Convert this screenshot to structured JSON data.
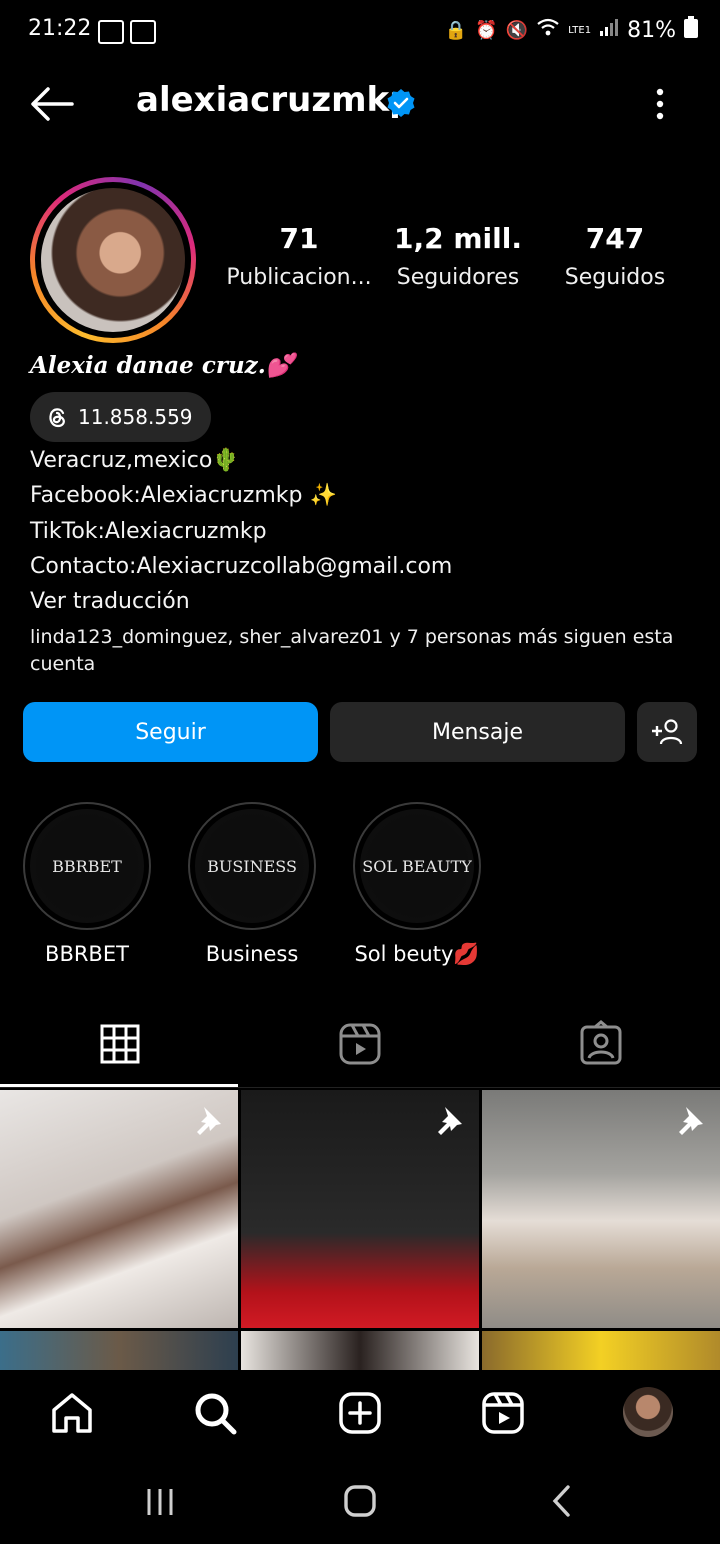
{
  "status": {
    "time": "21:22",
    "battery": "81%",
    "net": "LTE1"
  },
  "header": {
    "username": "alexiacruzmkp",
    "verified": true
  },
  "stats": [
    {
      "value": "71",
      "label": "Publicacion..."
    },
    {
      "value": "1,2 mill.",
      "label": "Seguidores"
    },
    {
      "value": "747",
      "label": "Seguidos"
    }
  ],
  "profile": {
    "full_name": "Alexia danae cruz.💕",
    "threads_count": "11.858.559",
    "bio": [
      "Veracruz,mexico🌵",
      "Facebook:Alexiacruzmkp ✨",
      "TikTok:Alexiacruzmkp",
      "Contacto:Alexiacruzcollab@gmail.com"
    ],
    "translate": "Ver traducción",
    "followed_by": "linda123_dominguez, sher_alvarez01 y 7 personas más siguen esta cuenta"
  },
  "actions": {
    "follow": "Seguir",
    "message": "Mensaje"
  },
  "highlights": [
    {
      "cover": "BBRBET",
      "label": "BBRBET"
    },
    {
      "cover": "BUSINESS",
      "label": "Business"
    },
    {
      "cover": "SOL BEAUTY",
      "label": "Sol beuty💋"
    }
  ],
  "colors": {
    "accent": "#0095f6",
    "dark_button": "#262626",
    "background": "#000000"
  }
}
